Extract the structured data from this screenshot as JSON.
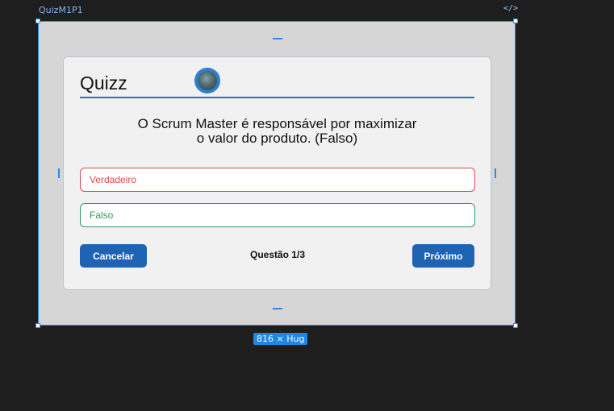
{
  "canvas": {
    "frame_name": "QuizM1P1",
    "code_icon": "</>",
    "size_badge": "816 × Hug",
    "accent_color": "#2d8ae6"
  },
  "quiz": {
    "title": "Quizz",
    "avatar_icon": "user-avatar-icon",
    "question_line1": "O Scrum Master é responsável por maximizar",
    "question_line2": "o valor do produto. (Falso)",
    "options": [
      {
        "label": "Verdadeiro",
        "color": "#d94b4b"
      },
      {
        "label": "Falso",
        "color": "#2f9a5a"
      }
    ],
    "cancel_label": "Cancelar",
    "counter": "Questão 1/3",
    "next_label": "Próximo",
    "primary_color": "#1f63b4"
  }
}
